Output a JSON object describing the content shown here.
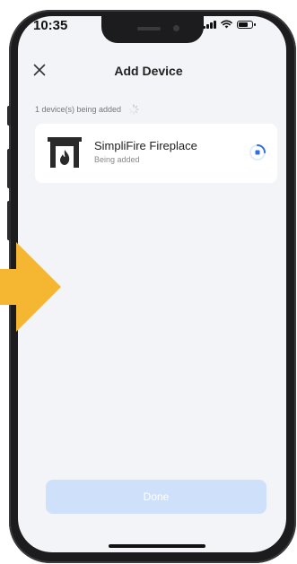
{
  "status_bar": {
    "time": "10:35"
  },
  "nav": {
    "title": "Add Device"
  },
  "progress": {
    "text": "1 device(s) being added"
  },
  "device": {
    "name": "SimpliFire Fireplace",
    "status": "Being added"
  },
  "actions": {
    "done_label": "Done"
  },
  "colors": {
    "accent": "#2f6fe0",
    "done_disabled": "#cfe0fb",
    "arrow": "#f5b731"
  }
}
